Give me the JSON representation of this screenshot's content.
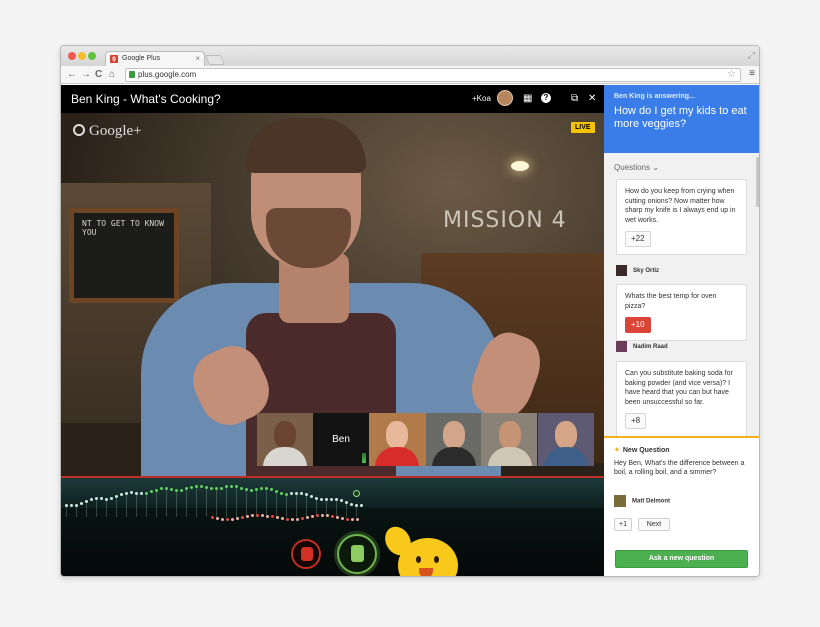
{
  "browser": {
    "tab_title": "Google Plus",
    "tab_close": "×",
    "url": "plus.google.com",
    "nav": {
      "back": "←",
      "forward": "→",
      "reload": "C",
      "home": "⌂"
    },
    "star": "☆",
    "menu": "≡"
  },
  "hangout": {
    "title": "Ben King - What's Cooking?",
    "plus_label": "+Koa",
    "logo_text": "Google+",
    "live_badge": "LIVE",
    "icons": [
      "apps-grid-icon",
      "help-icon",
      "popout-icon",
      "close-icon"
    ],
    "chalkboard_text": "NT TO GET TO KNOW YOU",
    "sign_text": "MISSION 4",
    "participants": [
      {
        "name": "",
        "skin": "#6b4431",
        "shirt": "#d9d6d0",
        "bg": "#7a6048"
      },
      {
        "name": "Ben",
        "skin": "",
        "shirt": "",
        "bg": "#131313"
      },
      {
        "name": "",
        "skin": "#e7b99a",
        "shirt": "#d82c2c",
        "bg": "#b17a4a"
      },
      {
        "name": "",
        "skin": "#d3a68b",
        "shirt": "#2b2b2b",
        "bg": "#6a6a66"
      },
      {
        "name": "",
        "skin": "#c79375",
        "shirt": "#cfc6b6",
        "bg": "#8a8277"
      },
      {
        "name": "",
        "skin": "#d6a588",
        "shirt": "#3e5f8a",
        "bg": "#5e5a73"
      }
    ]
  },
  "sidebar": {
    "answering_label": "Ben King is answering...",
    "answering_question": "How do I get my kids to eat more veggies?",
    "questions_header": "Questions",
    "questions": [
      {
        "text": "How do you keep from crying when cutting onions? Now matter how sharp my knife is I always end up in wet works.",
        "votes": "+22",
        "author": "Sky Ortiz",
        "active": false
      },
      {
        "text": "Whats the best temp for oven pizza?",
        "votes": "+10",
        "author": "Nadim Raad",
        "active": true
      },
      {
        "text": "Can you substitute baking soda for baking powder (and vice versa)? I have heard that you can but have been unsuccessful so far.",
        "votes": "+8",
        "author": "",
        "active": false
      }
    ],
    "new_question": {
      "label": "New Question",
      "text": "Hey Ben, What's the difference between a boil, a rolling boil, and a simmer?",
      "author": "Matt Delmont",
      "plus_one": "+1",
      "next": "Next"
    },
    "ask_button": "Ask a new question"
  },
  "colors": {
    "accent_blue": "#3a7de8",
    "vote_red": "#db4437",
    "ask_green": "#4caf50",
    "live_yellow": "#f7c200"
  }
}
